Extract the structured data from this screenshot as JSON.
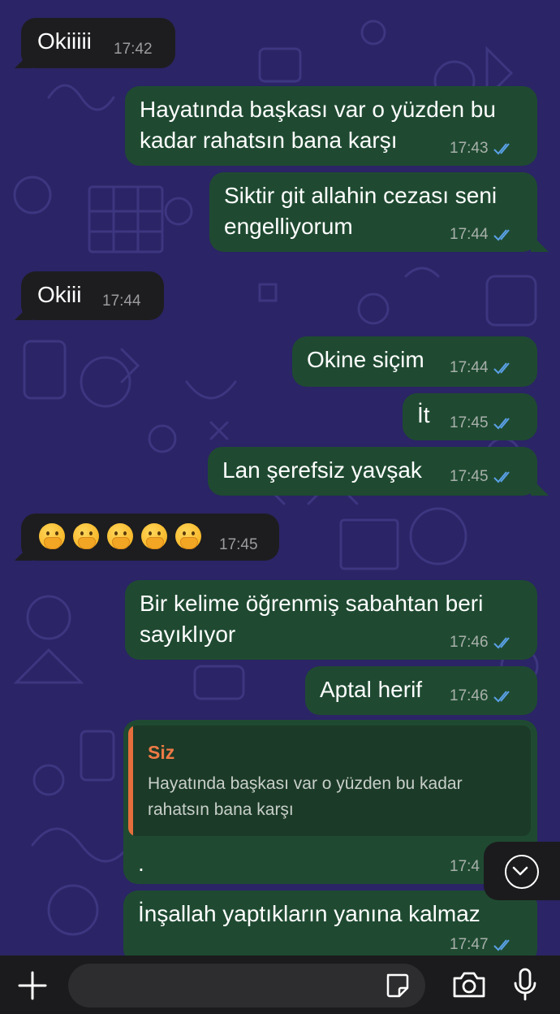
{
  "messages": [
    {
      "text": "Okiiiii",
      "time": "17:42"
    },
    {
      "text1": "Hayatında başkası var o yüzden bu",
      "text2": "kadar rahatsın bana karşı",
      "time": "17:43"
    },
    {
      "text1": "Siktir git allahin cezası seni",
      "text2": "engelliyorum",
      "time": "17:44"
    },
    {
      "text": "Okiii",
      "time": "17:44"
    },
    {
      "text": "Okine siçim",
      "time": "17:44"
    },
    {
      "text": "İt",
      "time": "17:45"
    },
    {
      "text": "Lan şerefsiz yavşak",
      "time": "17:45"
    },
    {
      "emoji_count": 5,
      "time": "17:45"
    },
    {
      "text1": "Bir kelime öğrenmiş sabahtan beri",
      "text2": "sayıklıyor",
      "time": "17:46"
    },
    {
      "text": "Aptal herif",
      "time": "17:46"
    },
    {
      "quote_author": "Siz",
      "quote_text": "Hayatında başkası var o yüzden bu kadar rahatsın bana karşı",
      "text": ".",
      "time": "17:4"
    },
    {
      "text": "İnşallah yaptıkların yanına kalmaz",
      "time": "17:47"
    }
  ],
  "colors": {
    "background": "#2b2466",
    "incoming_bubble": "#1d1d1f",
    "outgoing_bubble": "#1f4a31",
    "read_ticks": "#5aa0e6",
    "quote_accent": "#e56e3c"
  },
  "icons": [
    "plus-icon",
    "sticker-icon",
    "camera-icon",
    "microphone-icon",
    "chevron-down-icon",
    "double-check-icon"
  ]
}
